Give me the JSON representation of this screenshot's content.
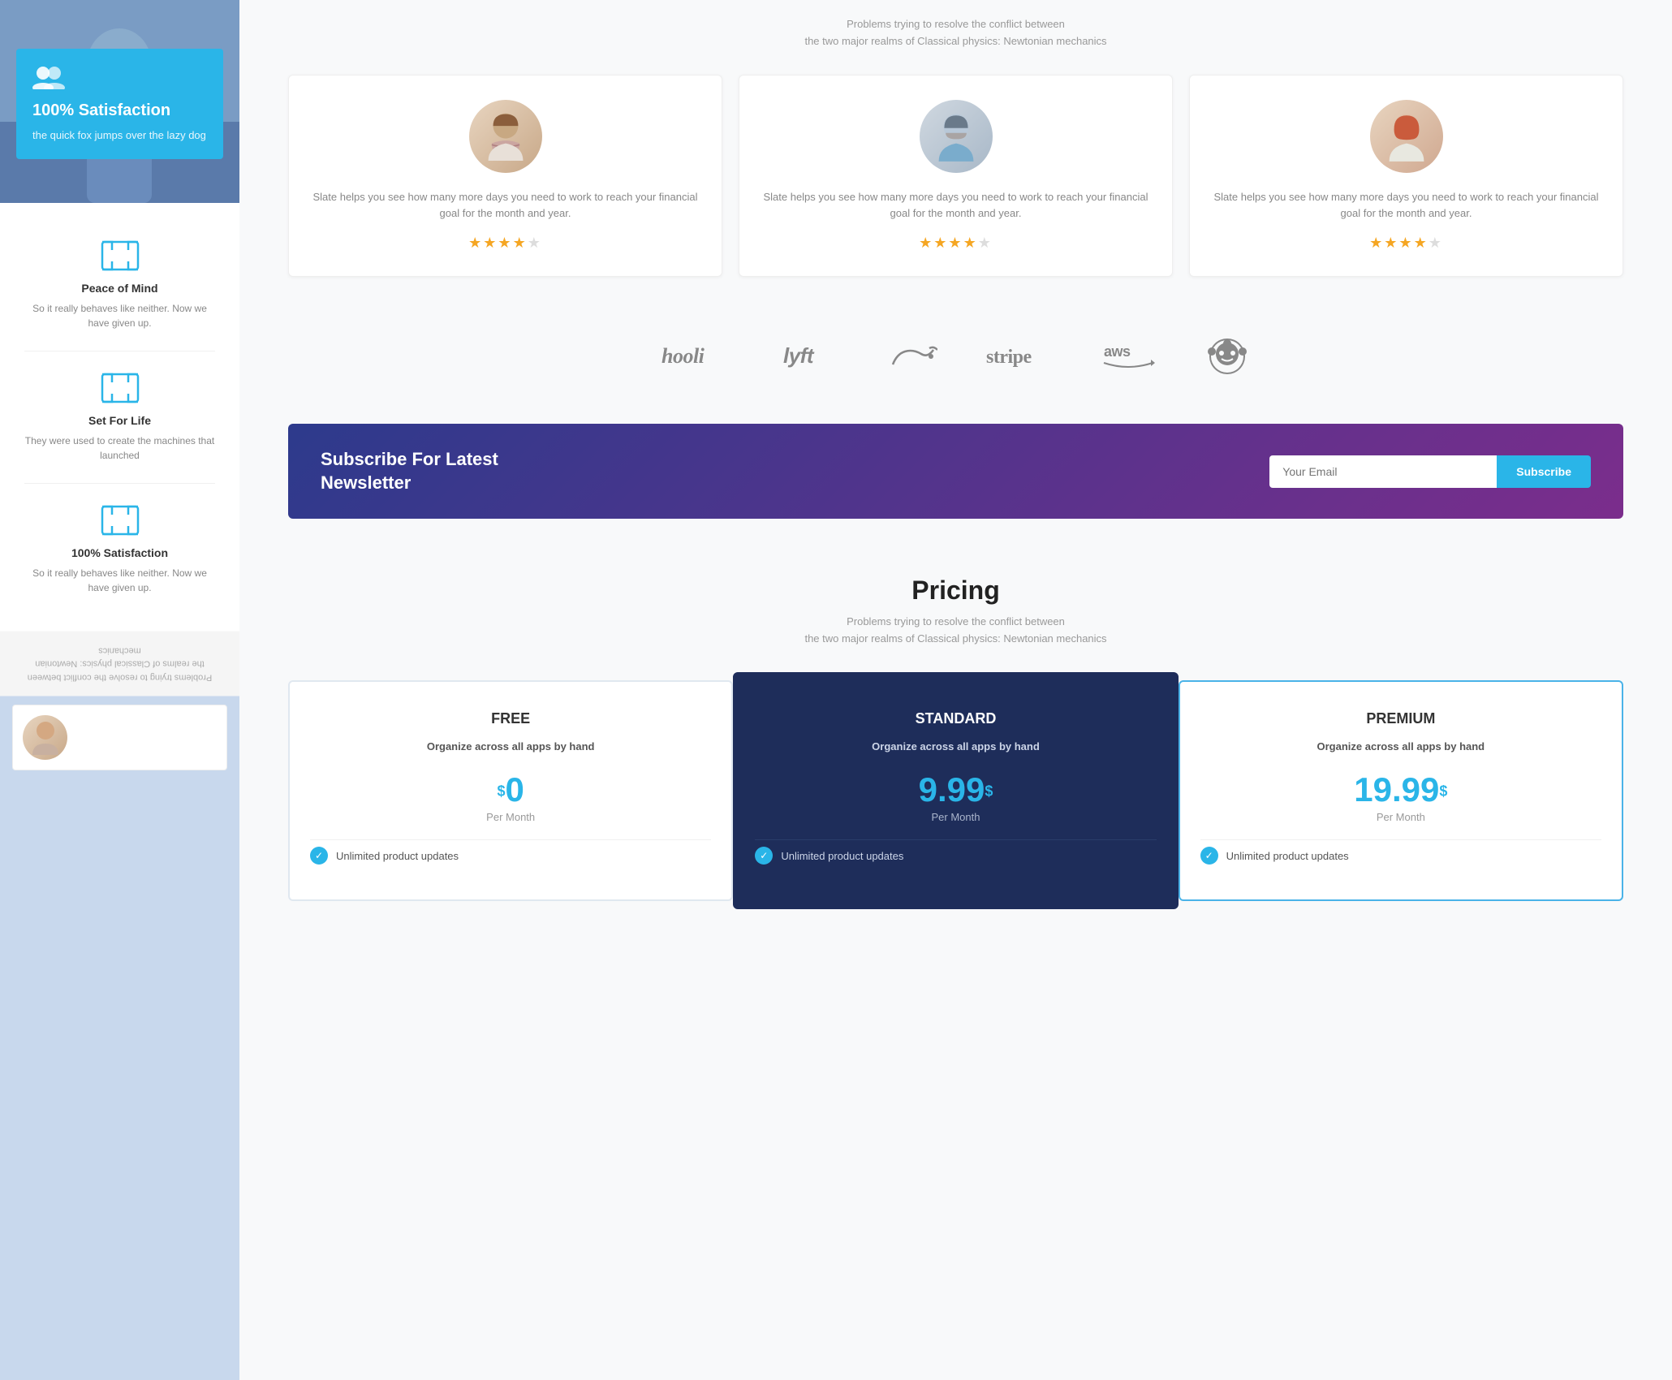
{
  "sidebar": {
    "hero": {
      "icon": "👥",
      "title": "100% Satisfaction",
      "text": "the quick fox jumps over the lazy dog"
    },
    "features": [
      {
        "id": "peace-of-mind",
        "title": "Peace of Mind",
        "desc": "So it really behaves like neither. Now we have given up."
      },
      {
        "id": "set-for-life",
        "title": "Set For Life",
        "desc": "They were used to create the machines that launched"
      },
      {
        "id": "satisfaction",
        "title": "100% Satisfaction",
        "desc": "So it really behaves like neither. Now we have given up."
      }
    ],
    "rotated_text": "Problems trying to resolve the conflict between the realms of Classical physics: Newtonian mechanics"
  },
  "intro": {
    "line1": "Problems trying to resolve the conflict between",
    "line2": "the two major realms of Classical physics: Newtonian mechanics"
  },
  "testimonials": [
    {
      "text": "Slate helps you see how many more days you need to work to reach your financial goal for the month and year.",
      "stars": 4.5
    },
    {
      "text": "Slate helps you see how many more days you need to work to reach your financial goal for the month and year.",
      "stars": 4.5
    },
    {
      "text": "Slate helps you see how many more days you need to work to reach your financial goal for the month and year.",
      "stars": 4
    }
  ],
  "logos": [
    "hooli",
    "lyft",
    "pied piper",
    "stripe",
    "aws",
    "reddit"
  ],
  "newsletter": {
    "title": "Subscribe For Latest\nNewsletter",
    "input_placeholder": "Your Email",
    "button_label": "Subscribe"
  },
  "pricing": {
    "title": "Pricing",
    "subtitle_line1": "Problems trying to resolve the conflict between",
    "subtitle_line2": "the two major realms of Classical physics: Newtonian mechanics",
    "plans": [
      {
        "name": "FREE",
        "desc": "Organize across all apps by hand",
        "price": "0",
        "price_sup": "$",
        "period": "Per Month",
        "features": [
          "Unlimited product updates"
        ]
      },
      {
        "name": "STANDARD",
        "desc": "Organize across all apps by hand",
        "price": "9.99",
        "price_sup": "$",
        "period": "Per Month",
        "features": [
          "Unlimited product updates"
        ],
        "highlight": true
      },
      {
        "name": "PREMIUM",
        "desc": "Organize across all apps by hand",
        "price": "19.99",
        "price_sup": "$",
        "period": "Per Month",
        "features": [
          "Unlimited product updates"
        ]
      }
    ]
  }
}
